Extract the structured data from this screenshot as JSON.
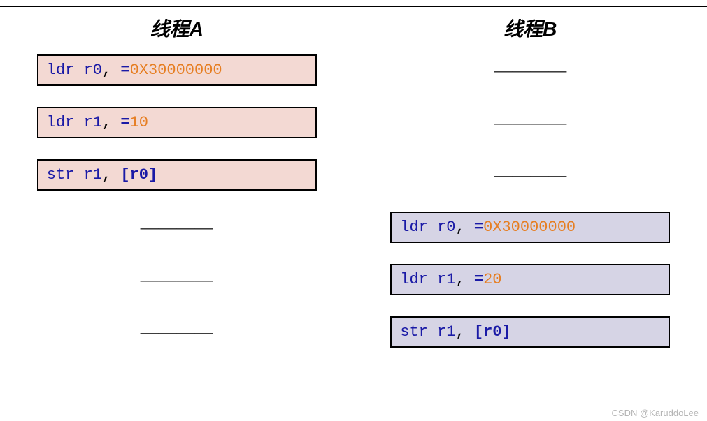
{
  "columns": {
    "a": {
      "title": "线程A"
    },
    "b": {
      "title": "线程B"
    }
  },
  "code": {
    "a": {
      "line1": {
        "mn": "ldr",
        "reg": "r0",
        "eq": "=",
        "val": "0X30000000"
      },
      "line2": {
        "mn": "ldr",
        "reg": "r1",
        "eq": "= ",
        "val": "10"
      },
      "line3": {
        "mn": "str",
        "reg": "r1",
        "arg": "[r0]"
      }
    },
    "b": {
      "line1": {
        "mn": "ldr",
        "reg": "r0",
        "eq": "=",
        "val": "0X30000000"
      },
      "line2": {
        "mn": "ldr",
        "reg": "r1",
        "eq": "= ",
        "val": "20"
      },
      "line3": {
        "mn": "str",
        "reg": "r1",
        "arg": "[r0]"
      }
    }
  },
  "dash": "————",
  "watermark": "CSDN @KaruddoLee"
}
